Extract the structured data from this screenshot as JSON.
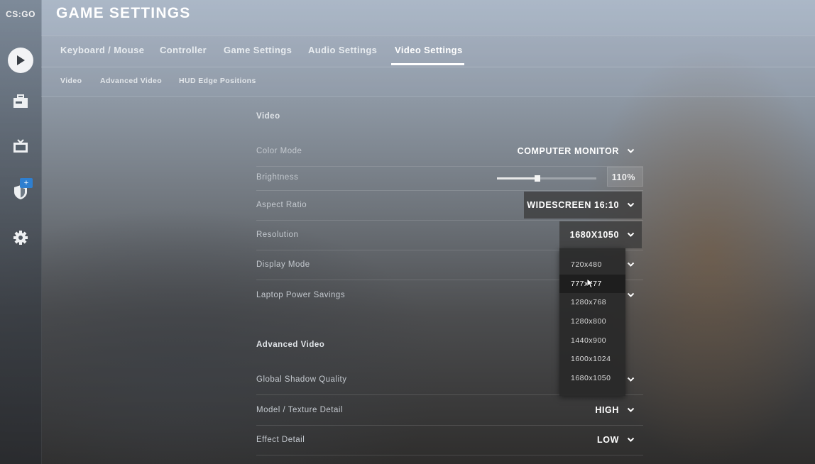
{
  "sidebar": {
    "logo": "CS:GO",
    "items": [
      {
        "name": "play"
      },
      {
        "name": "inventory"
      },
      {
        "name": "watch"
      },
      {
        "name": "shield",
        "badge": "+"
      },
      {
        "name": "settings"
      }
    ]
  },
  "header": {
    "title": "GAME SETTINGS"
  },
  "tabs": [
    {
      "label": "Keyboard / Mouse"
    },
    {
      "label": "Controller"
    },
    {
      "label": "Game Settings"
    },
    {
      "label": "Audio Settings"
    },
    {
      "label": "Video Settings",
      "active": true
    }
  ],
  "subtabs": [
    {
      "label": "Video"
    },
    {
      "label": "Advanced Video"
    },
    {
      "label": "HUD Edge Positions"
    }
  ],
  "video": {
    "title": "Video",
    "rows": [
      {
        "label": "Color Mode",
        "value": "COMPUTER MONITOR"
      },
      {
        "label": "Brightness",
        "value": "110%",
        "slider_fraction": 0.41
      },
      {
        "label": "Aspect Ratio",
        "value": "WIDESCREEN 16:10"
      },
      {
        "label": "Resolution",
        "value": "1680X1050"
      },
      {
        "label": "Display Mode",
        "value": ""
      },
      {
        "label": "Laptop Power Savings",
        "value": ""
      }
    ]
  },
  "advanced": {
    "title": "Advanced Video",
    "rows": [
      {
        "label": "Global Shadow Quality",
        "value": ""
      },
      {
        "label": "Model / Texture Detail",
        "value": "HIGH"
      },
      {
        "label": "Effect Detail",
        "value": "LOW"
      }
    ]
  },
  "resolution_dropdown": {
    "options": [
      "720x480",
      "777x777",
      "1280x768",
      "1280x800",
      "1440x900",
      "1600x1024",
      "1680x1050"
    ],
    "hovered": "777x777"
  },
  "colors": {
    "accent": "#ffffff",
    "badge": "#2e7fd0",
    "dropdown_bg": "#282828"
  }
}
